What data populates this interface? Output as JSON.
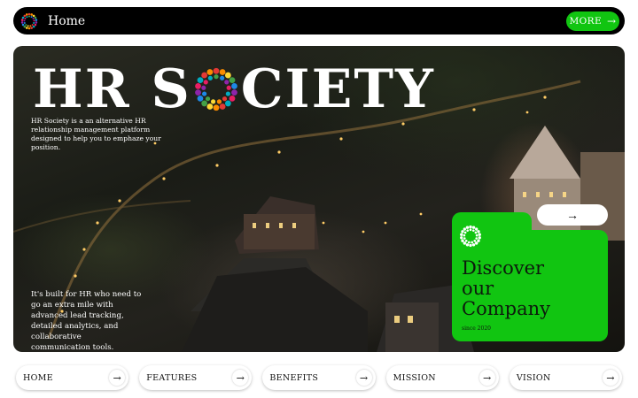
{
  "header": {
    "title": "Home",
    "more_label": "MORE",
    "logo_icon": "dot-ring-logo-icon"
  },
  "hero": {
    "brand_before": "HR S",
    "brand_after": "CIETY",
    "intro": "HR Society is a an alternative HR relationship management platform designed to help you to emphaze your position.",
    "intro2": "It's built for HR who need to go an extra mile with advanced lead tracking, detailed analytics, and collaborative communication tools."
  },
  "card": {
    "title_line1": "Discover",
    "title_line2": "our",
    "title_line3": "Company",
    "since": "since 2020"
  },
  "nav": {
    "items": [
      {
        "label": "HOME"
      },
      {
        "label": "FEATURES"
      },
      {
        "label": "BENEFITS"
      },
      {
        "label": "MISSION"
      },
      {
        "label": "VISION"
      }
    ]
  },
  "colors": {
    "accent_green": "#11c511",
    "bar_black": "#000000"
  }
}
